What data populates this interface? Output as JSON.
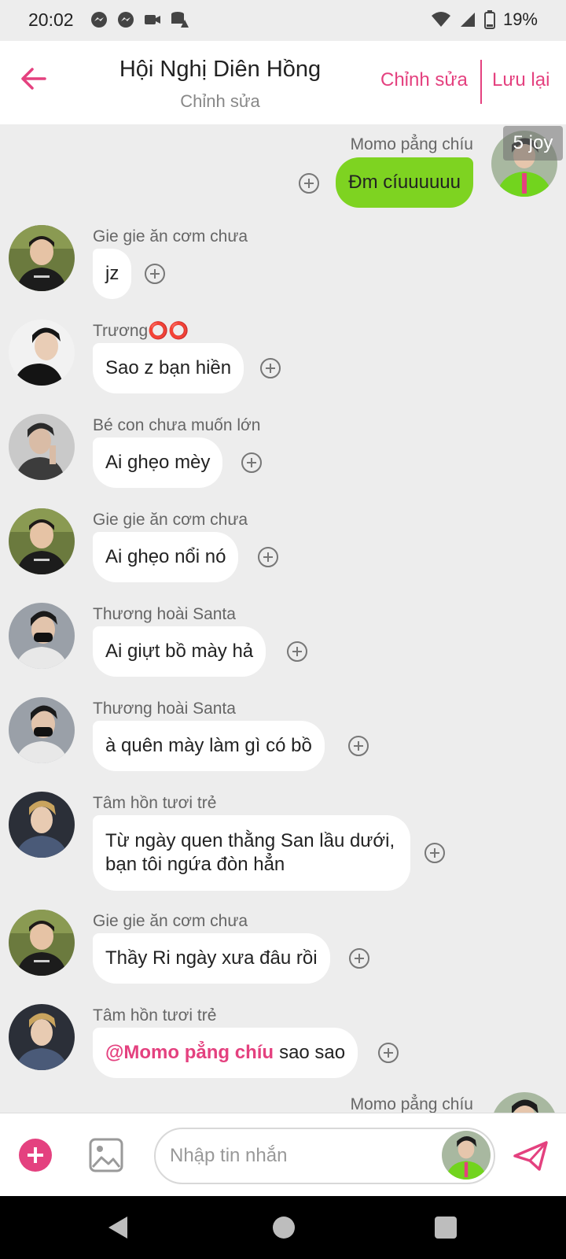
{
  "status_bar": {
    "time": "20:02",
    "battery": "19%",
    "icons_left": [
      "messenger-icon",
      "messenger-icon",
      "video-icon",
      "storage-alert-icon"
    ],
    "icons_right": [
      "wifi-icon",
      "cellular-icon",
      "battery-icon"
    ]
  },
  "header": {
    "title": "Hội Nghị Diên Hồng",
    "subtitle": "Chỉnh sửa",
    "edit_label": "Chỉnh sửa",
    "save_label": "Lưu lại",
    "back_icon": "back-arrow-icon"
  },
  "chat": {
    "messages": [
      {
        "sender": "Momo pẳng chíu",
        "text": "Đm cíuuuuuu",
        "outgoing": true,
        "badge": "5 joy"
      },
      {
        "sender": "Gie gie ăn cơm chưa",
        "text": "jz",
        "outgoing": false
      },
      {
        "sender": "Trương⭕⭕",
        "text": "Sao z bạn hiền",
        "outgoing": false
      },
      {
        "sender": "Bé con chưa muốn lớn",
        "text": "Ai ghẹo mèy",
        "outgoing": false
      },
      {
        "sender": "Gie gie ăn cơm chưa",
        "text": "Ai ghẹo nổi nó",
        "outgoing": false
      },
      {
        "sender": "Thương hoài Santa",
        "text": "Ai giựt bồ mày hả",
        "outgoing": false
      },
      {
        "sender": "Thương hoài Santa",
        "text": "à quên mày làm gì có bồ",
        "outgoing": false
      },
      {
        "sender": "Tâm hồn tươi trẻ",
        "text": "Từ ngày quen thằng San lầu dưới, bạn tôi ngứa đòn hẳn",
        "outgoing": false
      },
      {
        "sender": "Gie gie ăn cơm chưa",
        "text": "Thầy Ri ngày xưa đâu rồi",
        "outgoing": false
      },
      {
        "sender": "Tâm hồn tươi trẻ",
        "mention": "@Momo pẳng chíu",
        "text": "sao sao",
        "outgoing": false
      },
      {
        "sender": "Momo pẳng chíu",
        "outgoing": true,
        "partial": true
      }
    ]
  },
  "composer": {
    "placeholder": "Nhập tin nhắn",
    "add_icon": "plus-icon",
    "image_icon": "image-icon",
    "send_icon": "send-icon"
  },
  "nav_bar": {
    "back_icon": "nav-back-icon",
    "home_icon": "nav-home-icon",
    "recent_icon": "nav-recent-icon"
  },
  "colors": {
    "accent": "#e4417f",
    "outgoing_bubble": "#7ed321",
    "incoming_bubble": "#ffffff",
    "chat_background": "#ededed"
  }
}
